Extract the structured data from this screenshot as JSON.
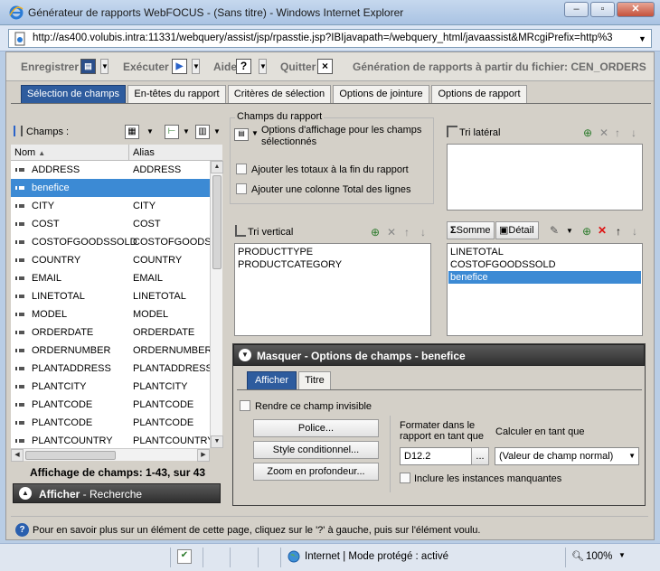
{
  "window": {
    "title": "Générateur de rapports WebFOCUS - (Sans titre) - Windows Internet Explorer",
    "url": "http://as400.volubis.intra:11331/webquery/assist/jsp/rpasstie.jsp?IBIjavapath=/webquery_html/javaassist&MRcgiPrefix=http%3"
  },
  "toolbar": {
    "save": "Enregistrer",
    "run": "Exécuter",
    "help": "Aide",
    "help_icon": "?",
    "quit": "Quitter",
    "quit_icon": "×",
    "report_title": "Génération de rapports à partir du fichier: CEN_ORDERS"
  },
  "tabs": [
    "Sélection de champs",
    "En-têtes du rapport",
    "Critères de sélection",
    "Options de jointure",
    "Options de rapport"
  ],
  "fields_panel": {
    "label": "Champs :",
    "col_name": "Nom",
    "col_alias": "Alias",
    "rows": [
      {
        "name": "ADDRESS",
        "alias": "ADDRESS"
      },
      {
        "name": "benefice",
        "alias": ""
      },
      {
        "name": "CITY",
        "alias": "CITY"
      },
      {
        "name": "COST",
        "alias": "COST"
      },
      {
        "name": "COSTOFGOODSSOLD",
        "alias": "COSTOFGOODSS"
      },
      {
        "name": "COUNTRY",
        "alias": "COUNTRY"
      },
      {
        "name": "EMAIL",
        "alias": "EMAIL"
      },
      {
        "name": "LINETOTAL",
        "alias": "LINETOTAL"
      },
      {
        "name": "MODEL",
        "alias": "MODEL"
      },
      {
        "name": "ORDERDATE",
        "alias": "ORDERDATE"
      },
      {
        "name": "ORDERNUMBER",
        "alias": "ORDERNUMBER"
      },
      {
        "name": "PLANTADDRESS",
        "alias": "PLANTADDRESS"
      },
      {
        "name": "PLANTCITY",
        "alias": "PLANTCITY"
      },
      {
        "name": "PLANTCODE",
        "alias": "PLANTCODE"
      },
      {
        "name": "PLANTCODE",
        "alias": "PLANTCODE"
      },
      {
        "name": "PLANTCOUNTRY",
        "alias": "PLANTCOUNTRY"
      }
    ],
    "count_text": "Affichage de champs: 1-43, sur 43",
    "show_search_bold": "Afficher",
    "show_search_rest": " - Recherche"
  },
  "report_fields": {
    "group_label": "Champs du rapport",
    "display_options": "Options d'affichage pour les champs sélectionnés",
    "add_totals": "Ajouter les totaux à la fin du rapport",
    "add_total_col": "Ajouter une colonne Total des lignes",
    "side_sort": "Tri latéral",
    "vertical_sort": "Tri vertical",
    "vertical_items": [
      "PRODUCTTYPE",
      "PRODUCTCATEGORY"
    ],
    "sum_label": "Somme",
    "detail_label": "Détail",
    "sum_items": [
      "LINETOTAL",
      "COSTOFGOODSSOLD",
      "benefice"
    ]
  },
  "field_options": {
    "header_bold": "Masquer",
    "header_rest": " - Options de champs - benefice",
    "tab_show": "Afficher",
    "tab_title": "Titre",
    "invisible": "Rendre ce champ invisible",
    "font_btn": "Police...",
    "cond_style_btn": "Style conditionnel...",
    "drill_btn": "Zoom en profondeur...",
    "format_label": "Formater dans le rapport en tant que",
    "format_value": "D12.2",
    "format_browse": "...",
    "calc_label": "Calculer en tant que",
    "calc_value": "(Valeur de champ normal)",
    "missing": "Inclure les instances manquantes"
  },
  "help_text": "Pour en savoir plus sur un élément de cette page, cliquez sur le '?' à gauche, puis sur l'élément voulu.",
  "status": {
    "zone": "Internet | Mode protégé : activé",
    "zoom": "100%"
  }
}
